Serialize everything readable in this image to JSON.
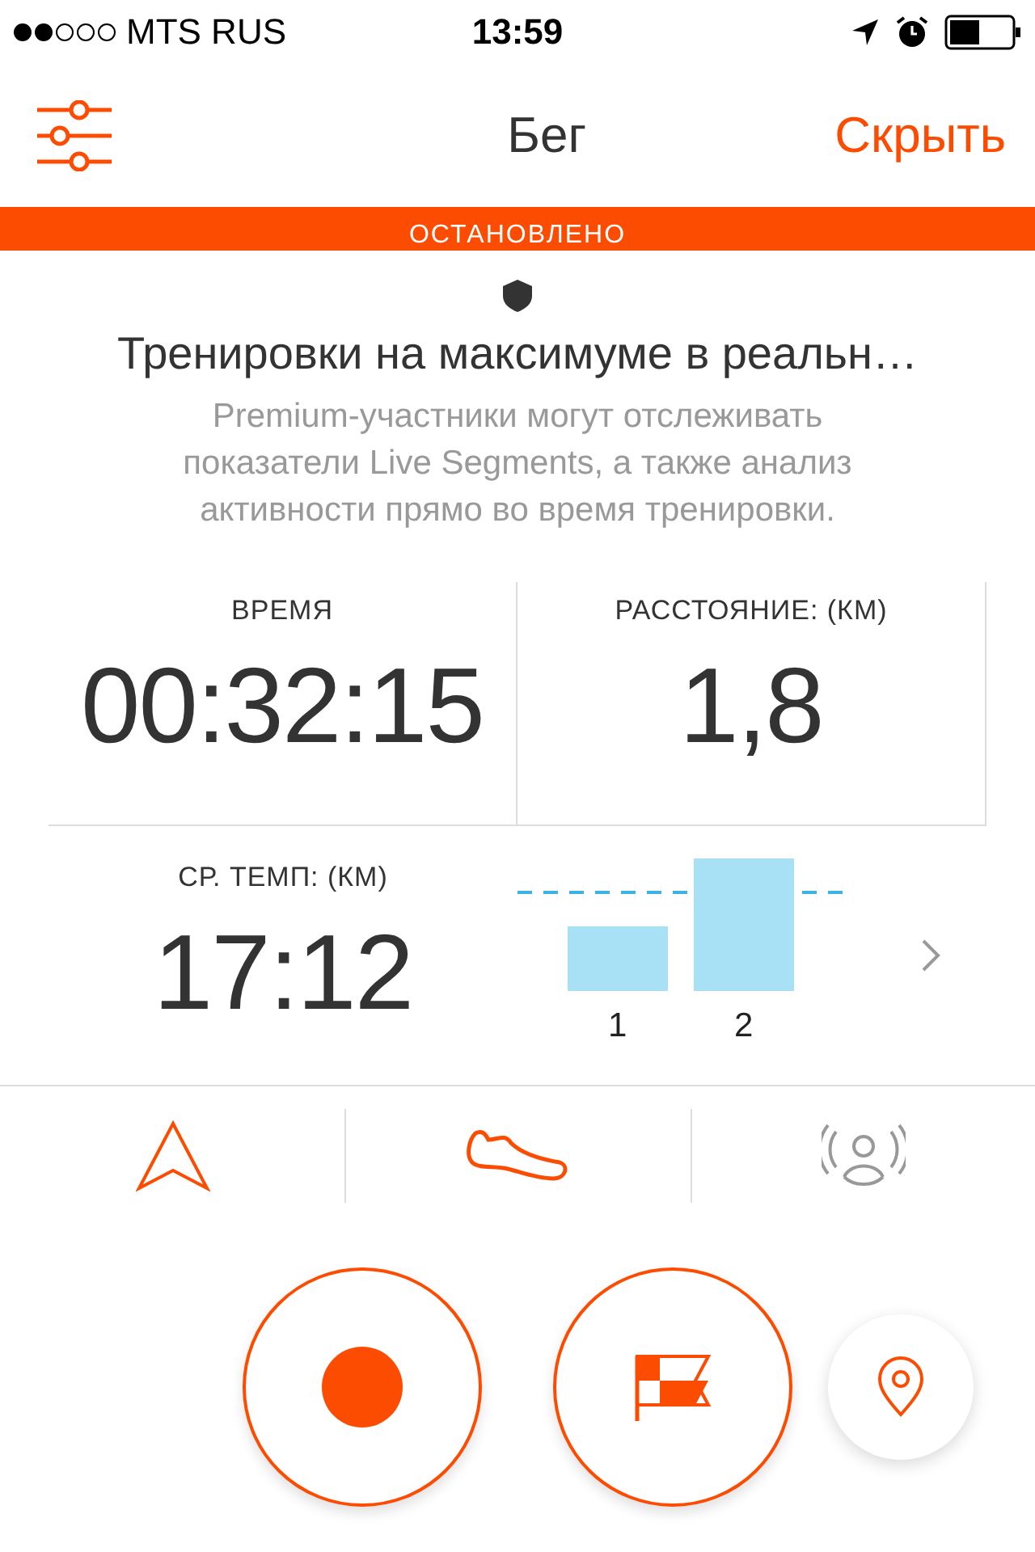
{
  "status_bar": {
    "carrier": "MTS RUS",
    "time": "13:59"
  },
  "nav": {
    "title": "Бег",
    "action": "Скрыть"
  },
  "banner": {
    "text": "ОСТАНОВЛЕНО"
  },
  "promo": {
    "title": "Тренировки на максимуме в реальн…",
    "text": "Premium-участники могут отслеживать показатели Live Segments, а также анализ активности прямо во время тренировки."
  },
  "stats": [
    {
      "label": "ВРЕМЯ",
      "value": "00:32:15"
    },
    {
      "label": "РАССТОЯНИЕ: (КМ)",
      "value": "1,8"
    },
    {
      "label": "СР. ТЕМП: (КМ)",
      "value": "17:12"
    }
  ],
  "splits": {
    "labels": [
      "1",
      "2"
    ]
  },
  "tabs": [
    {
      "kind": "navigation",
      "active": true
    },
    {
      "kind": "shoe",
      "active": true
    },
    {
      "kind": "beacon",
      "active": false
    }
  ],
  "controls": [
    {
      "kind": "record"
    },
    {
      "kind": "lap"
    },
    {
      "kind": "location"
    }
  ]
}
